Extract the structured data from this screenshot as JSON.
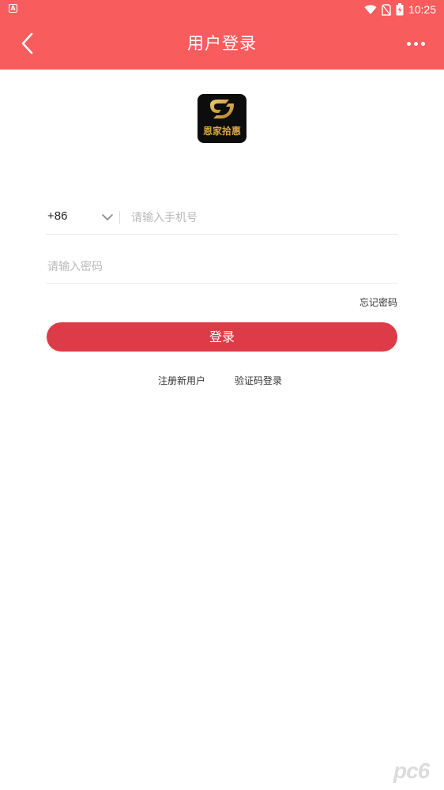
{
  "status_bar": {
    "time": "10:25",
    "icons": [
      "app-notification-icon",
      "wifi-icon",
      "no-sim-icon",
      "battery-charging-icon"
    ]
  },
  "header": {
    "title": "用户登录",
    "background_color": "#f85c5c",
    "back_icon": "chevron-left-icon",
    "more_icon": "more-horizontal-icon"
  },
  "logo": {
    "text": "恩家拾惠"
  },
  "form": {
    "country_code": "+86",
    "phone_placeholder": "请输入手机号",
    "phone_value": "",
    "password_placeholder": "请输入密码",
    "password_value": "",
    "forgot_label": "忘记密码",
    "login_label": "登录",
    "login_color": "#de3b49"
  },
  "links": {
    "register": "注册新用户",
    "sms_login": "验证码登录"
  },
  "watermark": {
    "text": "pc6"
  }
}
